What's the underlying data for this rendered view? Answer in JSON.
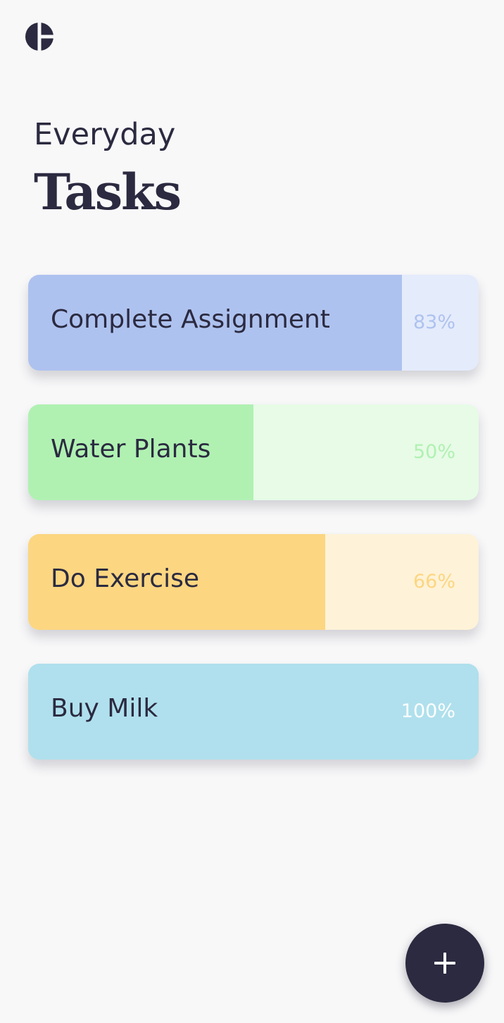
{
  "header": {
    "logo_icon": "app-logo-icon",
    "subtitle": "Everyday",
    "title": "Tasks"
  },
  "colors": {
    "text": "#2b2a40",
    "background": "#f8f8f9",
    "fab": "#2b2a40"
  },
  "tasks": [
    {
      "name": "Complete Assignment",
      "percent_label": "83%",
      "progress": 0.83,
      "fill_color": "#aec2ef",
      "track_color": "#e4ebfb",
      "percent_color": "#aec2ef"
    },
    {
      "name": "Water Plants",
      "percent_label": "50%",
      "progress": 0.5,
      "fill_color": "#b0f1b2",
      "track_color": "#e7fbe6",
      "percent_color": "#b0f1b2"
    },
    {
      "name": "Do Exercise",
      "percent_label": "66%",
      "progress": 0.66,
      "fill_color": "#fcd681",
      "track_color": "#fef2d8",
      "percent_color": "#fcd681"
    },
    {
      "name": "Buy Milk",
      "percent_label": "100%",
      "progress": 1.0,
      "fill_color": "#b0e0ed",
      "track_color": "#b0e0ed",
      "percent_color": "#ffffff"
    }
  ],
  "fab": {
    "icon": "plus-icon"
  }
}
